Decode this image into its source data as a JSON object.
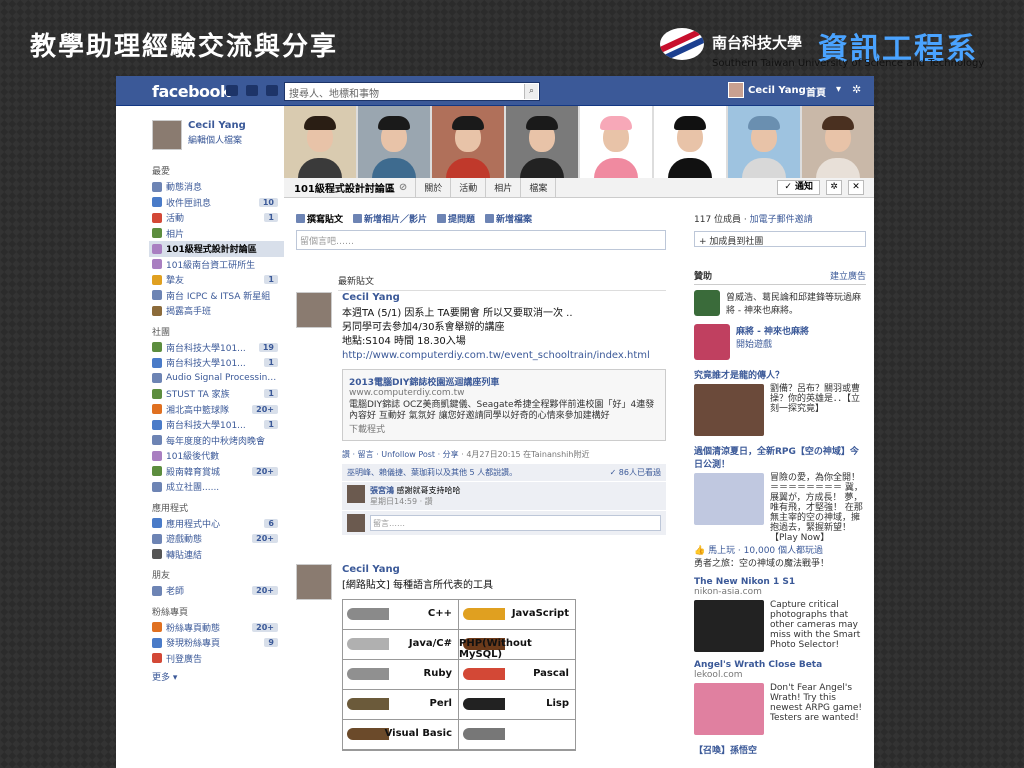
{
  "slide": {
    "title": "教學助理經驗交流與分享",
    "logo_cn": "南台科技大學",
    "logo_big": "資訊工程系",
    "logo_en": "Southern Taiwan University of Science and Technology"
  },
  "topbar": {
    "logo": "facebook",
    "search_placeholder": "搜尋人、地標和事物",
    "user_name": "Cecil Yang",
    "home_label": "首頁"
  },
  "profile": {
    "name": "Cecil Yang",
    "edit": "編輯個人檔案"
  },
  "sidebar": {
    "favorites_header": "最愛",
    "favorites": [
      {
        "label": "動態消息",
        "count": "",
        "color": "#6d84b4"
      },
      {
        "label": "收件匣訊息",
        "count": "10",
        "color": "#4a7bc8"
      },
      {
        "label": "活動",
        "count": "1",
        "color": "#d34836"
      },
      {
        "label": "相片",
        "count": "",
        "color": "#5c8d3e"
      },
      {
        "label": "101級程式設計討論區",
        "count": "",
        "color": "#a97fc1",
        "active": true
      },
      {
        "label": "101級南台資工研所生",
        "count": "",
        "color": "#a97fc1"
      },
      {
        "label": "摯友",
        "count": "1",
        "color": "#e0a020"
      },
      {
        "label": "南台 ICPC & ITSA 新星組",
        "count": "",
        "color": "#6d84b4"
      },
      {
        "label": "揭露高手班",
        "count": "",
        "color": "#8c6b3a"
      }
    ],
    "groups_header": "社團",
    "groups": [
      {
        "label": "南台科技大學101...",
        "count": "19",
        "color": "#5c8d3e"
      },
      {
        "label": "南台科技大學101...",
        "count": "1",
        "color": "#4a7bc8"
      },
      {
        "label": "Audio Signal Processing...",
        "count": "",
        "color": "#6d84b4"
      },
      {
        "label": "STUST TA 家族",
        "count": "1",
        "color": "#5c8d3e"
      },
      {
        "label": "湘北高中籃球隊",
        "count": "20+",
        "color": "#e07020"
      },
      {
        "label": "南台科技大學101...",
        "count": "1",
        "color": "#4a7bc8"
      },
      {
        "label": "每年度度的中秋烤肉晚會",
        "count": "",
        "color": "#6d84b4"
      },
      {
        "label": "101級後代數",
        "count": "",
        "color": "#a97fc1"
      },
      {
        "label": "殿南韓育賞城",
        "count": "20+",
        "color": "#5c8d3e"
      },
      {
        "label": "成立社團......",
        "count": "",
        "color": "#6d84b4"
      }
    ],
    "apps_header": "應用程式",
    "apps": [
      {
        "label": "應用程式中心",
        "count": "6",
        "color": "#4a7bc8"
      },
      {
        "label": "遊戲動態",
        "count": "20+",
        "color": "#6d84b4"
      },
      {
        "label": "轉貼連結",
        "count": "",
        "color": "#555555"
      }
    ],
    "friends_header": "朋友",
    "friends": [
      {
        "label": "老師",
        "count": "20+",
        "color": "#6d84b4"
      }
    ],
    "pages_header": "粉絲專頁",
    "pages": [
      {
        "label": "粉絲專頁動態",
        "count": "20+",
        "color": "#e07020"
      },
      {
        "label": "發現粉絲專頁",
        "count": "9",
        "color": "#4a7bc8"
      },
      {
        "label": "刊登廣告",
        "count": "",
        "color": "#d34836"
      }
    ],
    "more": "更多"
  },
  "cover_photos": [
    {
      "bg": "#d9cbb0",
      "shirt": "#3a3a3a",
      "hair": "#2a1e14"
    },
    {
      "bg": "#9aa6b0",
      "shirt": "#3e6b8f",
      "hair": "#1a1a1a"
    },
    {
      "bg": "#b0705a",
      "shirt": "#c0392b",
      "hair": "#1a1a1a"
    },
    {
      "bg": "#7a7a7a",
      "shirt": "#222222",
      "hair": "#1a1a1a"
    },
    {
      "bg": "#ffffff",
      "shirt": "#f08aa0",
      "hair": "#f7a8b8"
    },
    {
      "bg": "#ffffff",
      "shirt": "#111111",
      "hair": "#111111"
    },
    {
      "bg": "#9ec3e0",
      "shirt": "#d8d8d8",
      "hair": "#6a8fb0"
    },
    {
      "bg": "#c9b8a8",
      "shirt": "#e8e0d8",
      "hair": "#4a3020"
    }
  ],
  "group": {
    "name": "101級程式設計討論區",
    "tabs": [
      "關於",
      "活動",
      "相片",
      "檔案"
    ],
    "notify": "✓ 通知"
  },
  "composer": {
    "tabs": [
      "撰寫貼文",
      "新增相片／影片",
      "提問題",
      "新增檔案"
    ],
    "placeholder": "留個言吧……"
  },
  "feed": {
    "header": "最新貼文",
    "post1": {
      "author": "Cecil Yang",
      "line1": "本週TA (5/1) 因系上 TA要開會 所以又要取消一次 ..",
      "line2": "另同學可去參加4/30系會舉辦的講座",
      "line3": "地點:S104 時間 18.30入場",
      "link": "http://www.computerdiy.com.tw/event_schooltrain/index.html",
      "attach_title": "2013電腦DIY錦誌校園巡迴講座列車",
      "attach_url": "www.computerdiy.com.tw",
      "attach_desc": "電腦DIY錦誌 OCZ美商凱鍵儀、Seagate希捷全程夥伴前進校園「好」4連發內容好 互動好 氣氛好 讓您好邀請同學以好奇的心情來參加建構好",
      "attach_more": "下載程式",
      "meta_actions": "讚 · 留言 · Unfollow Post · 分享",
      "meta_time": "· 4月27日20:15 在Tainanshih附近",
      "likes": "巫明峰、賴儀捷、葉珈莉以及其他 5 人都說讚。",
      "seen": "✓ 86人已看過",
      "comment_name": "張宮鴻",
      "comment_text": "感謝就哥支持哈哈",
      "comment_date": "星期日14:59 · 讚",
      "comment_placeholder": "留言……"
    },
    "post2": {
      "author": "Cecil Yang",
      "text": "[網路貼文] 每種語言所代表的工具",
      "languages": [
        {
          "name": "C++",
          "color": "#8a8a8a"
        },
        {
          "name": "JavaScript",
          "color": "#e0a020"
        },
        {
          "name": "Java/C#",
          "color": "#b0b0b0"
        },
        {
          "name": "PHP(Without MySQL)",
          "color": "#6b3a1a"
        },
        {
          "name": "Ruby",
          "color": "#909090"
        },
        {
          "name": "Pascal",
          "color": "#d34836"
        },
        {
          "name": "Perl",
          "color": "#6b5a3a"
        },
        {
          "name": "Lisp",
          "color": "#222222"
        },
        {
          "name": "Visual Basic",
          "color": "#6b4a2a"
        },
        {
          "name": "",
          "color": "#777777"
        }
      ]
    }
  },
  "right": {
    "members_prefix": "117 位成員 · ",
    "members_link": "加電子郵件邀請",
    "add_shelf": "+ 加成員到社團",
    "sponsored_header": "贊助",
    "create_ad": "建立廣告",
    "game1": "曾威浩、葛民論和邱建鋒等玩過麻將 - 神來也麻將。",
    "game2_title": "麻將 - 神來也麻將",
    "game2_sub": "開始遊戲",
    "ads": [
      {
        "title": "究竟誰才是龍的傳人？",
        "url": "",
        "desc": "劉備？呂布？關羽或曹操？你的英雄是．．【立刻一探究竟】",
        "img": "#6b4a3a"
      },
      {
        "title": "過個清涼夏日，全新RPG【空の神域】今日公測！",
        "url": "",
        "desc": "冒險の愛，為你全開！＝＝＝＝＝＝＝＝ 冀，展翼が，方成長！ 夢，唯有飛，才堅強！ 在那無主宰的空の神域，擁抱過去，緊握新望！【Play Now】",
        "img": "#c0c8e0"
      },
      {
        "title": "The New Nikon 1 S1",
        "url": "nikon-asia.com",
        "desc": "Capture critical photographs that other cameras may miss with the Smart Photo Selector!",
        "img": "#222222"
      },
      {
        "title": "Angel's Wrath Close Beta",
        "url": "lekool.com",
        "desc": "Don't Fear Angel's Wrath! Try this newest ARPG game! Testers are wanted!",
        "img": "#e080a0"
      }
    ],
    "ad2_likes": "👍 馬上玩 · 10,000 個人都玩過",
    "ad2_tag": "勇者之旅：空の神域の魔法戰爭！",
    "bottom": "【召喚】孫悟空"
  }
}
